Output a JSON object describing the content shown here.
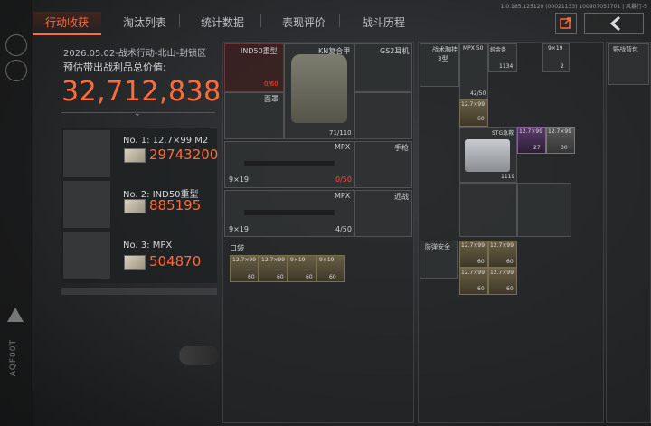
{
  "tabs": [
    {
      "label": "行动收获",
      "active": true
    },
    {
      "label": "淘汰列表",
      "active": false
    },
    {
      "label": "统计数据",
      "active": false
    },
    {
      "label": "表现评价",
      "active": false
    },
    {
      "label": "战斗历程",
      "active": false
    }
  ],
  "version_text": "1.0.185.125120 (00021133) 100907051701 | 风暴行-5",
  "header": {
    "date_line": "2026.05.02-战术行动-北山-封锁区",
    "estimate_label": "预估带出战利品总价值:",
    "total_value": "32,712,838"
  },
  "top_items": [
    {
      "rank": "No. 1: 12.7×99 M2",
      "value": "29743200"
    },
    {
      "rank": "No. 2: IND50重型",
      "value": "885195"
    },
    {
      "rank": "No. 3: MPX",
      "value": "504870"
    }
  ],
  "equip": {
    "helmet": {
      "name": "IND50重型",
      "durability": "0/60"
    },
    "face": {
      "name": "面罩"
    },
    "armor": {
      "name": "KN复合甲",
      "durability": "71/110"
    },
    "headset": {
      "name": "GS2耳机"
    },
    "primary1": {
      "name": "MPX",
      "caliber": "9×19",
      "ammo": "0/50"
    },
    "primary2": {
      "name": "MPX",
      "caliber": "9×19",
      "ammo": "4/50"
    },
    "pistol": {
      "name": "手枪"
    },
    "melee": {
      "name": "近战"
    },
    "pouch": {
      "name": "口袋"
    }
  },
  "pocket_items": [
    {
      "cal": "12.7×99",
      "count": "60"
    },
    {
      "cal": "12.7×99",
      "count": "60"
    },
    {
      "cal": "9×19",
      "count": "60"
    },
    {
      "cal": "9×19",
      "count": "60"
    }
  ],
  "rig": {
    "name": "战术胸挂",
    "sub": "3型"
  },
  "backpack_items": [
    {
      "name": "MPX 50",
      "count": "42/50"
    },
    {
      "name": "纯金条",
      "count": "1134"
    },
    {
      "name": "9×19",
      "count": "2"
    },
    {
      "name": "12.7×99",
      "count": "60"
    },
    {
      "name": "STG急救",
      "count": "1119"
    },
    {
      "name": "12.7×99",
      "count": "27"
    },
    {
      "name": "12.7×99",
      "count": "30"
    }
  ],
  "safe": {
    "name": "防弹安全"
  },
  "safe_items": [
    {
      "cal": "12.7×99",
      "count": "60"
    },
    {
      "cal": "12.7×99",
      "count": "60"
    },
    {
      "cal": "12.7×99",
      "count": "60"
    },
    {
      "cal": "12.7×99",
      "count": "60"
    }
  ],
  "right_panel": {
    "name": "野战背包"
  },
  "rail_text": "AQF00T",
  "colors": {
    "accent": "#ff6b3a",
    "panel": "#2a2c2e"
  }
}
